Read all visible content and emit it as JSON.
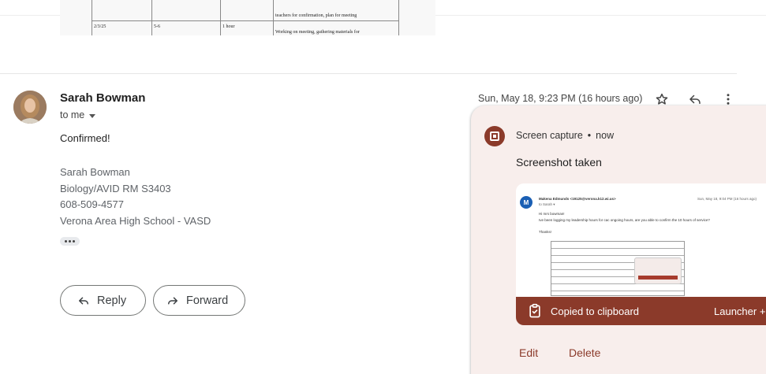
{
  "previous_email_table": {
    "rows": [
      {
        "date": "",
        "hours": "",
        "duration": "",
        "activity": "teachers for confirmation, plan for meeting"
      },
      {
        "date": "2/3/25",
        "hours": "5-6",
        "duration": "1 hour",
        "activity": "Working on meeting, gathering materials for"
      }
    ]
  },
  "message": {
    "sender_name": "Sarah Bowman",
    "recipient_label": "to me",
    "timestamp": "Sun, May 18, 9:23 PM (16 hours ago)",
    "body": "Confirmed!",
    "signature": [
      "Sarah Bowman",
      "Biology/AVID RM S3403",
      "608-509-4577",
      "Verona Area High School - VASD"
    ],
    "icons": {
      "star": "star-icon",
      "reply": "reply-icon",
      "more": "more-vert-icon",
      "ellipsis": "show-trimmed-content-icon"
    }
  },
  "actions": {
    "reply_label": "Reply",
    "forward_label": "Forward"
  },
  "notification": {
    "app_name": "Screen capture",
    "separator": "•",
    "time": "now",
    "title": "Screenshot taken",
    "thumbnail": {
      "avatar_letter": "M",
      "sender_line": "Makena Edmunds <19125@verona.k12.wi.us>",
      "to_line": "to Sarah ▾",
      "date_line": "Sun, May 18, 9:04 PM (16 hours ago)",
      "greeting": "Hi mrs bowman!",
      "question": "Ive been logging my leadership hours for cac ongoing hours, are you able to confirm the 10 hours of service?",
      "closing": "Thanks!"
    },
    "clipboard_label": "Copied to clipboard",
    "launcher_label": "Launcher +",
    "edit_label": "Edit",
    "delete_label": "Delete",
    "colors": {
      "accent": "#8b3a2a",
      "background": "#f8eeec"
    }
  }
}
